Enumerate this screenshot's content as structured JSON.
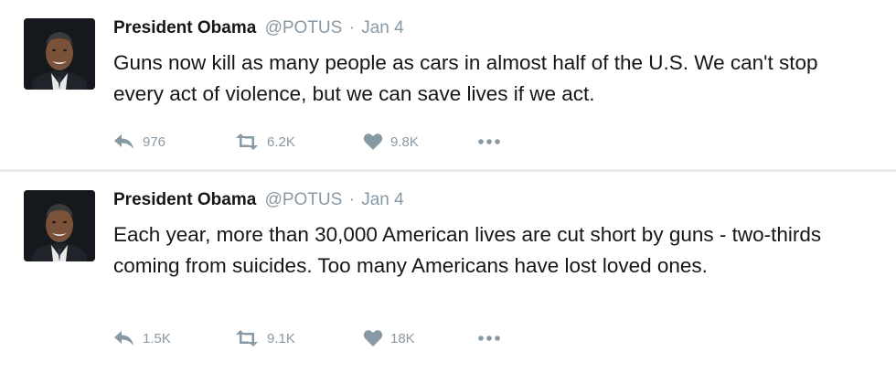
{
  "tweets": [
    {
      "author_name": "President Obama",
      "handle": "@POTUS",
      "separator": "·",
      "date": "Jan 4",
      "text": "Guns now kill as many people as cars in almost half of the U.S. We can't stop every act of violence, but we can save lives if we act.",
      "replies": "976",
      "retweets": "6.2K",
      "likes": "9.8K",
      "avatar_icon": "avatar-photo",
      "more_icon": "ellipsis-icon"
    },
    {
      "author_name": "President Obama",
      "handle": "@POTUS",
      "separator": "·",
      "date": "Jan 4",
      "text": "Each year, more than 30,000 American lives are cut short by guns - two-thirds coming from suicides. Too many Americans have lost loved ones.",
      "replies": "1.5K",
      "retweets": "9.1K",
      "likes": "18K",
      "avatar_icon": "avatar-photo",
      "more_icon": "ellipsis-icon"
    }
  ],
  "colors": {
    "text": "#14171a",
    "secondary": "#8899a6",
    "divider": "#e6ecf0",
    "background": "#ffffff"
  }
}
